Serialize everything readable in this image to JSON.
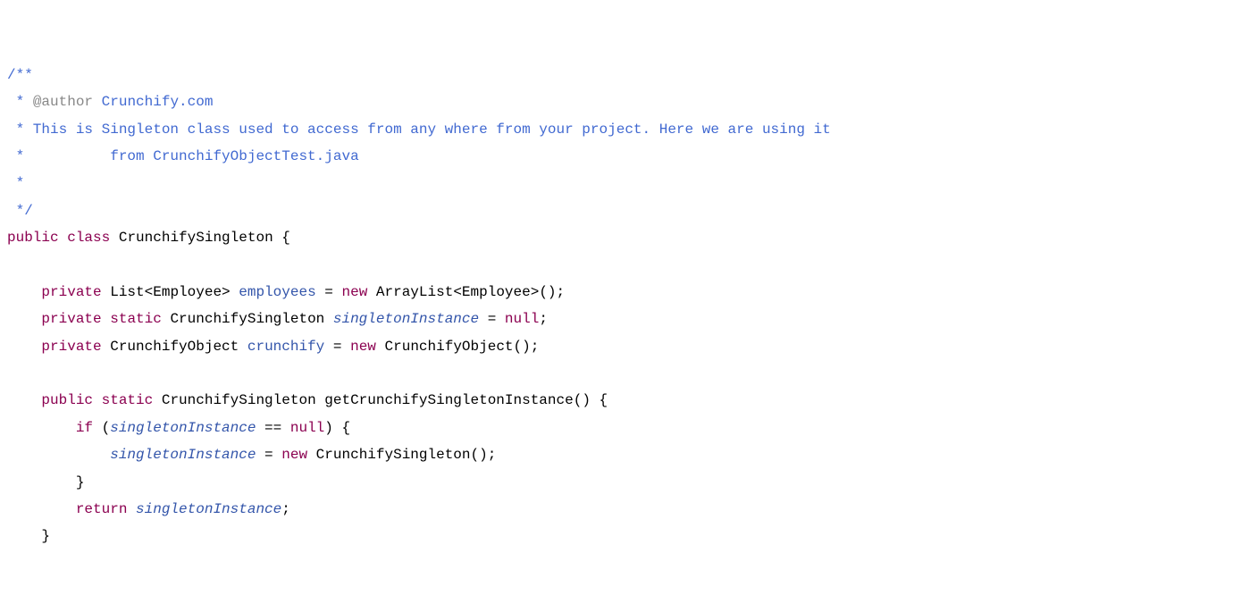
{
  "code": {
    "l1": "/**",
    "l2a": " * ",
    "l2b": "@author",
    "l2c": " Crunchify.com",
    "l3": " * This is Singleton class used to access from any where from your project. Here we are using it",
    "l4": " *          from CrunchifyObjectTest.java",
    "l5": " * ",
    "l6": " */",
    "l7a": "public",
    "l7b": " ",
    "l7c": "class",
    "l7d": " CrunchifySingleton {",
    "l8": "",
    "l9a": "    ",
    "l9b": "private",
    "l9c": " List<Employee> ",
    "l9d": "employees",
    "l9e": " = ",
    "l9f": "new",
    "l9g": " ArrayList<Employee>();",
    "l10a": "    ",
    "l10b": "private",
    "l10c": " ",
    "l10d": "static",
    "l10e": " CrunchifySingleton ",
    "l10f": "singletonInstance",
    "l10g": " = ",
    "l10h": "null",
    "l10i": ";",
    "l11a": "    ",
    "l11b": "private",
    "l11c": " CrunchifyObject ",
    "l11d": "crunchify",
    "l11e": " = ",
    "l11f": "new",
    "l11g": " CrunchifyObject();",
    "l12": "",
    "l13a": "    ",
    "l13b": "public",
    "l13c": " ",
    "l13d": "static",
    "l13e": " CrunchifySingleton getCrunchifySingletonInstance() {",
    "l14a": "        ",
    "l14b": "if",
    "l14c": " (",
    "l14d": "singletonInstance",
    "l14e": " == ",
    "l14f": "null",
    "l14g": ") {",
    "l15a": "            ",
    "l15b": "singletonInstance",
    "l15c": " = ",
    "l15d": "new",
    "l15e": " CrunchifySingleton();",
    "l16": "        }",
    "l17a": "        ",
    "l17b": "return",
    "l17c": " ",
    "l17d": "singletonInstance",
    "l17e": ";",
    "l18": "    }"
  }
}
